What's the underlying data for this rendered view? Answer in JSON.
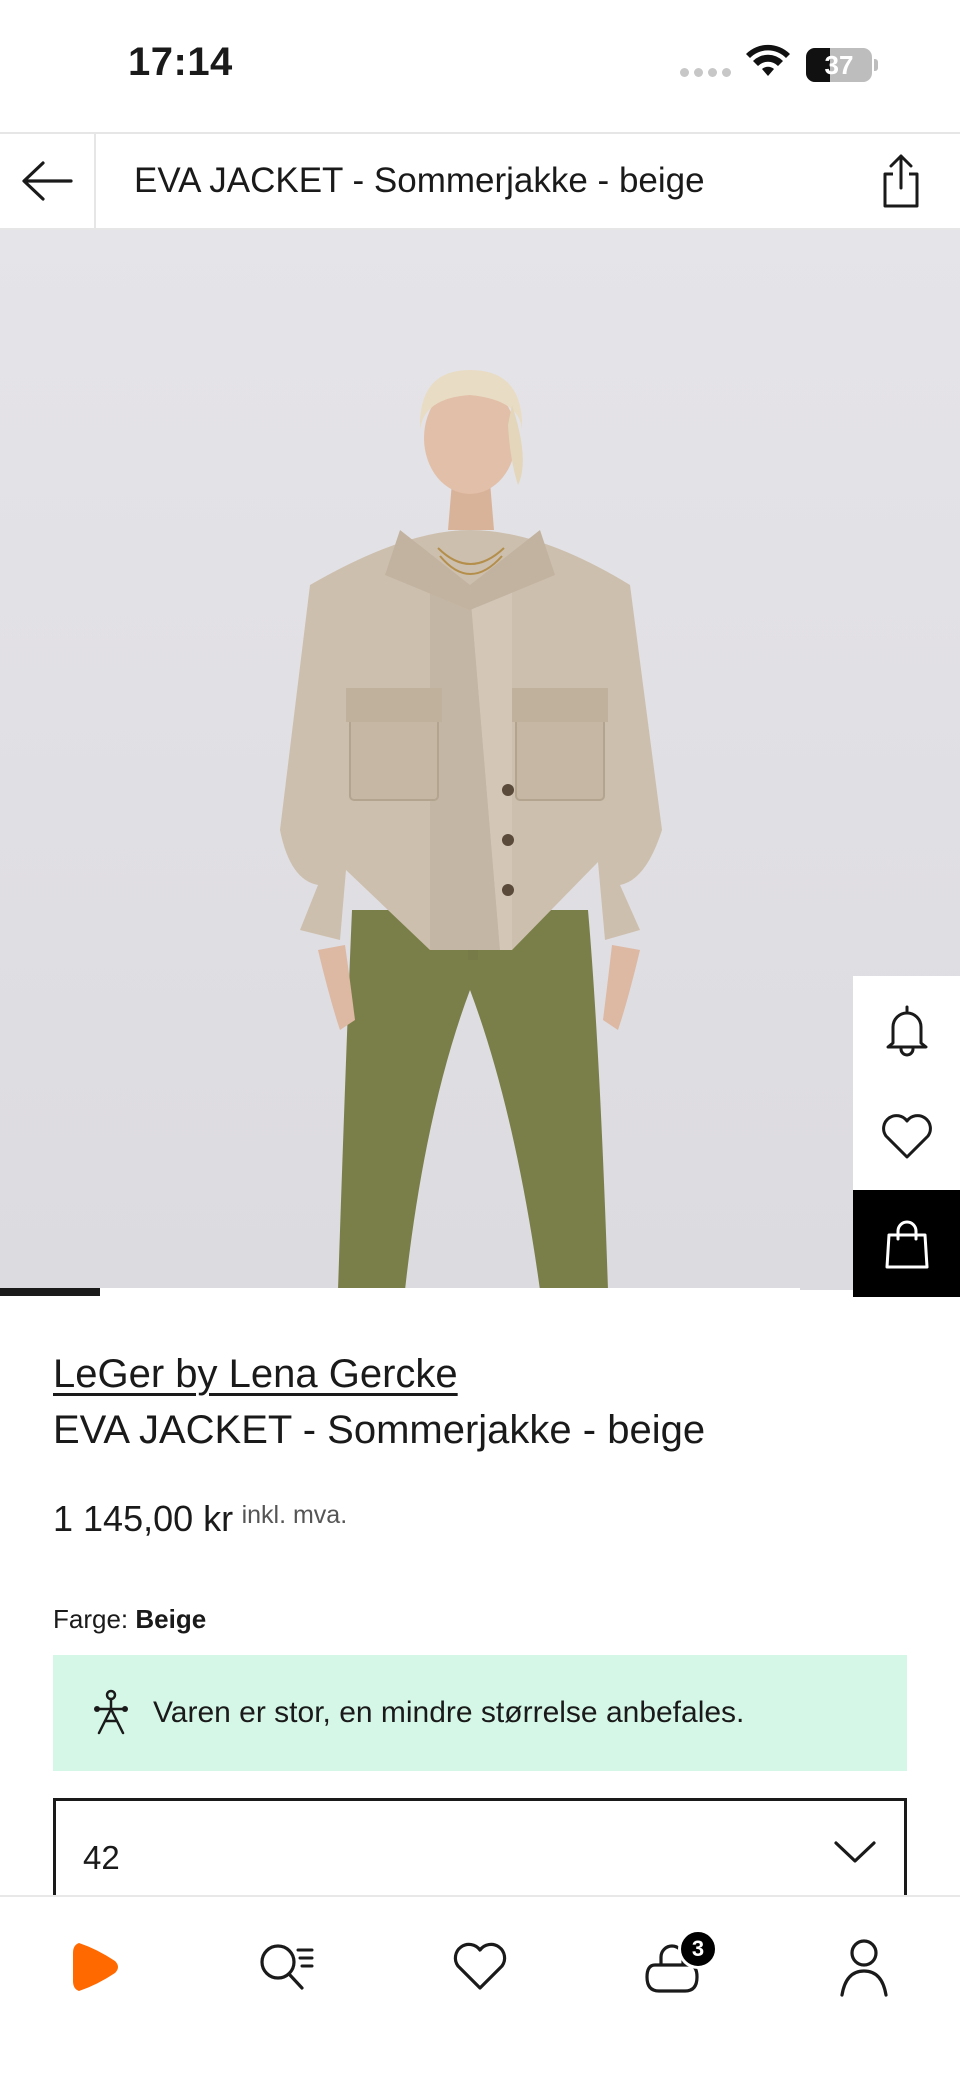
{
  "status_bar": {
    "time": "17:14",
    "battery": "37",
    "battery_level": 0.37,
    "icons": [
      "cellular-dots-icon",
      "wifi-icon",
      "battery-icon"
    ]
  },
  "header": {
    "title": "EVA JACKET - Sommerjakke - beige",
    "back_icon": "arrow-left-icon",
    "share_icon": "share-icon"
  },
  "gallery": {
    "progress_fraction": 0.125,
    "side_actions": [
      {
        "icon": "bell-icon"
      },
      {
        "icon": "heart-icon"
      },
      {
        "icon": "bag-icon"
      }
    ]
  },
  "product": {
    "brand": "LeGer by Lena Gercke",
    "name": "EVA JACKET - Sommerjakke - beige",
    "price": "1 145,00 kr",
    "price_tax_note": "inkl. mva.",
    "color_label": "Farge:",
    "color_value": "Beige",
    "size_advice": "Varen er stor, en mindre størrelse anbefales.",
    "selected_size": "42"
  },
  "bottom_nav": {
    "items": [
      {
        "icon": "zalando-logo-icon"
      },
      {
        "icon": "search-list-icon"
      },
      {
        "icon": "heart-icon"
      },
      {
        "icon": "bag-icon",
        "badge": "3"
      },
      {
        "icon": "profile-icon"
      }
    ]
  },
  "colors": {
    "advice_bg": "#d5f7e7",
    "brand_orange": "#ff6900",
    "jacket": "#cdbfae",
    "pants": "#7a7f4a"
  }
}
